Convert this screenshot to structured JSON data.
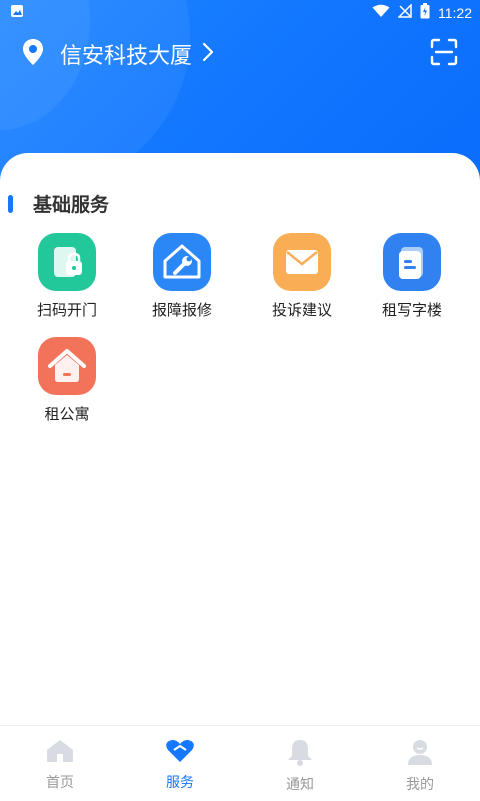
{
  "status": {
    "time": "11:22",
    "icons": [
      "image-icon",
      "wifi-icon",
      "no-signal-icon",
      "battery-charging-icon"
    ]
  },
  "header": {
    "location": "信安科技大厦",
    "location_icon": "location-pin-icon",
    "chevron_icon": "chevron-right-icon",
    "scan_icon": "scan-icon",
    "accent_color": "#1677ff"
  },
  "section": {
    "title": "基础服务"
  },
  "services": [
    {
      "label": "扫码开门",
      "icon": "door-lock-icon",
      "color": "#22c79a"
    },
    {
      "label": "报障报修",
      "icon": "house-wrench-icon",
      "color": "#2b86f6"
    },
    {
      "label": "投诉建议",
      "icon": "mail-icon",
      "color": "#f9ad55"
    },
    {
      "label": "租写字楼",
      "icon": "document-icon",
      "color": "#2f82f0"
    },
    {
      "label": "租公寓",
      "icon": "house-icon",
      "color": "#f3735a"
    }
  ],
  "tabs": [
    {
      "label": "首页",
      "icon": "home-icon",
      "active": false
    },
    {
      "label": "服务",
      "icon": "heart-icon",
      "active": true
    },
    {
      "label": "通知",
      "icon": "bell-icon",
      "active": false
    },
    {
      "label": "我的",
      "icon": "user-icon",
      "active": false
    }
  ]
}
